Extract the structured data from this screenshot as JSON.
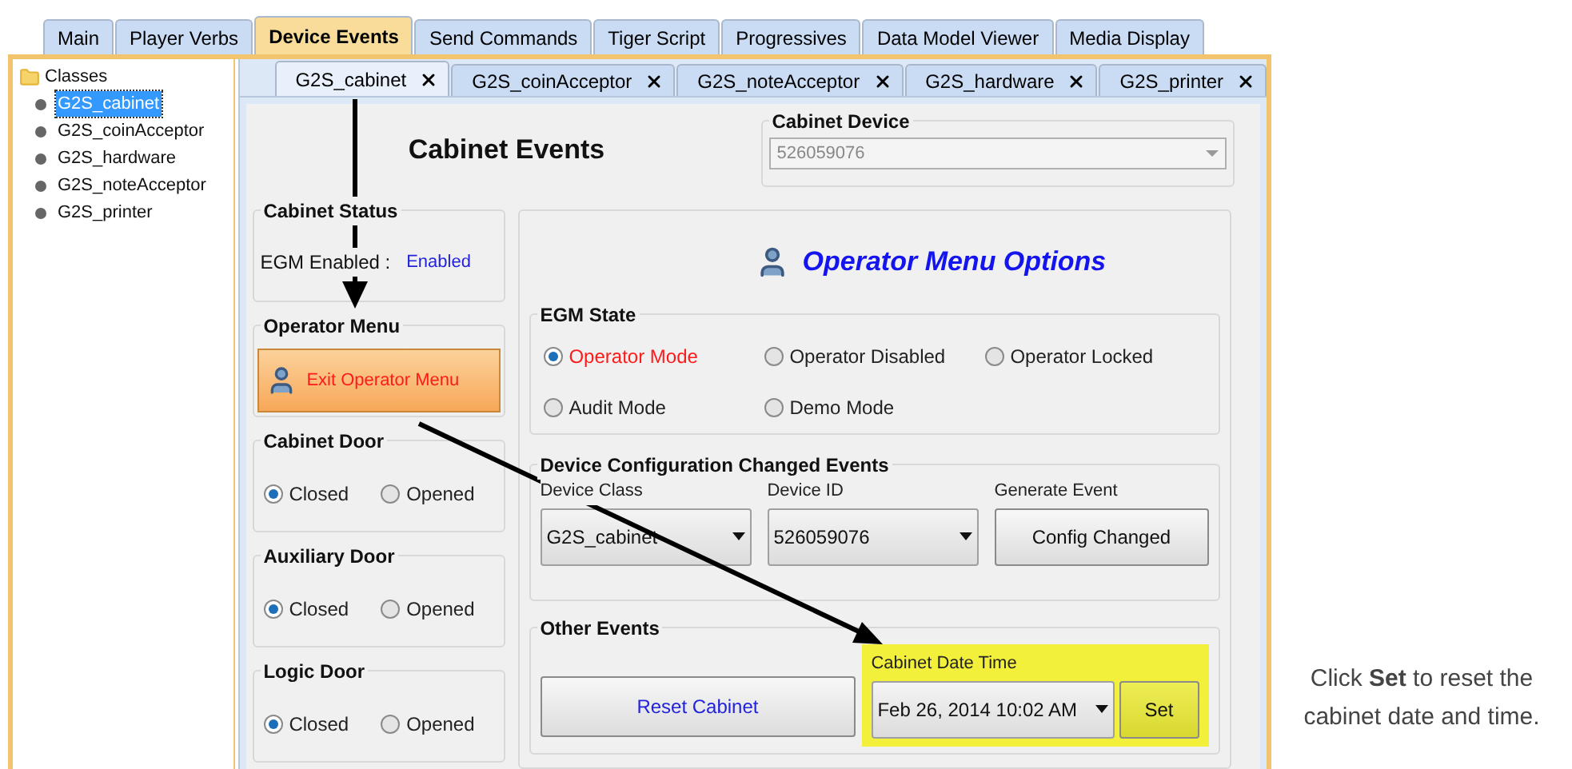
{
  "main_tabs": [
    {
      "label": "Main",
      "selected": false
    },
    {
      "label": "Player Verbs",
      "selected": false
    },
    {
      "label": "Device Events",
      "selected": true
    },
    {
      "label": "Send Commands",
      "selected": false
    },
    {
      "label": "Tiger Script",
      "selected": false
    },
    {
      "label": "Progressives",
      "selected": false
    },
    {
      "label": "Data Model Viewer",
      "selected": false
    },
    {
      "label": "Media Display",
      "selected": false
    }
  ],
  "tree": {
    "label": "Classes",
    "children": [
      {
        "label": "G2S_cabinet",
        "selected": true
      },
      {
        "label": "G2S_coinAcceptor",
        "selected": false
      },
      {
        "label": "G2S_hardware",
        "selected": false
      },
      {
        "label": "G2S_noteAcceptor",
        "selected": false
      },
      {
        "label": "G2S_printer",
        "selected": false
      }
    ]
  },
  "sub_tabs": [
    {
      "label": "G2S_cabinet",
      "selected": true
    },
    {
      "label": "G2S_coinAcceptor",
      "selected": false
    },
    {
      "label": "G2S_noteAcceptor",
      "selected": false
    },
    {
      "label": "G2S_hardware",
      "selected": false
    },
    {
      "label": "G2S_printer",
      "selected": false
    }
  ],
  "title": "Cabinet Events",
  "cabinet_device": {
    "label": "Cabinet Device",
    "value": "526059076"
  },
  "cabinet_status": {
    "title": "Cabinet Status",
    "label": "EGM Enabled :",
    "value": "Enabled"
  },
  "operator_menu": {
    "title": "Operator Menu",
    "button": "Exit Operator Menu"
  },
  "doors": [
    {
      "title": "Cabinet Door",
      "options": [
        {
          "label": "Closed",
          "selected": true
        },
        {
          "label": "Opened",
          "selected": false
        }
      ]
    },
    {
      "title": "Auxiliary Door",
      "options": [
        {
          "label": "Closed",
          "selected": true
        },
        {
          "label": "Opened",
          "selected": false
        }
      ]
    },
    {
      "title": "Logic Door",
      "options": [
        {
          "label": "Closed",
          "selected": true
        },
        {
          "label": "Opened",
          "selected": false
        }
      ]
    }
  ],
  "operator_options": {
    "title": "Operator Menu Options"
  },
  "egm_state": {
    "title": "EGM State",
    "options": [
      {
        "label": "Operator Mode",
        "selected": true
      },
      {
        "label": "Operator Disabled",
        "selected": false
      },
      {
        "label": "Operator Locked",
        "selected": false
      },
      {
        "label": "Audit Mode",
        "selected": false
      },
      {
        "label": "Demo Mode",
        "selected": false
      }
    ]
  },
  "config_events": {
    "title": "Device Configuration Changed Events",
    "device_class": {
      "label": "Device Class",
      "value": "G2S_cabinet"
    },
    "device_id": {
      "label": "Device ID",
      "value": "526059076"
    },
    "generate": {
      "label": "Generate Event",
      "button": "Config Changed"
    }
  },
  "other_events": {
    "title": "Other Events",
    "reset_button": "Reset Cabinet",
    "date_time": {
      "label": "Cabinet Date Time",
      "value": "Feb 26, 2014 10:02 AM",
      "button": "Set",
      "highlighted": true
    }
  },
  "caption": "Click **Set** to reset the cabinet date and time."
}
